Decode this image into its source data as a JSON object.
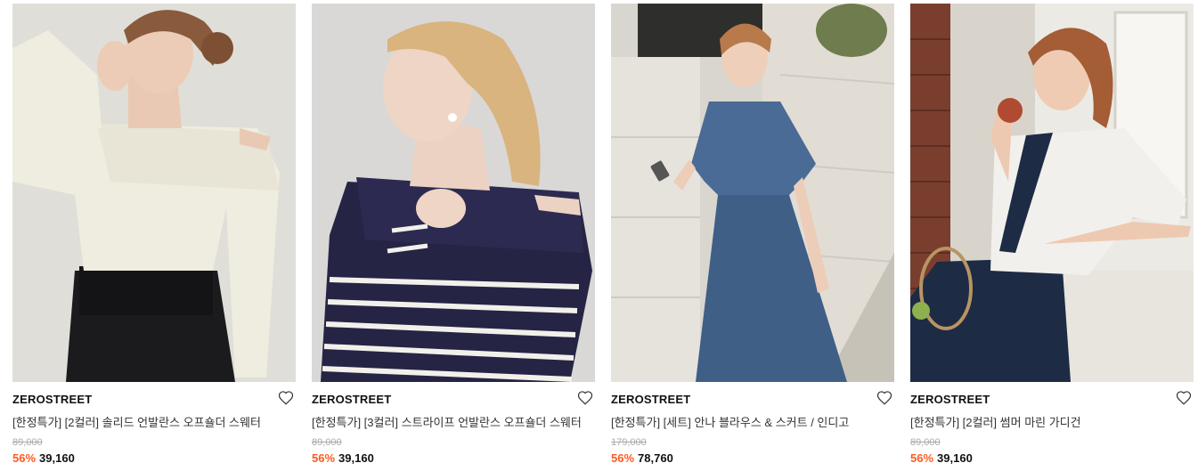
{
  "products": [
    {
      "brand": "ZEROSTREET",
      "title": "[한정특가] [2컬러] 솔리드 언발란스 오프숄더 스웨터",
      "original_price": "89,000",
      "discount": "56%",
      "price": "39,160",
      "image": "woman-in-cream-off-shoulder-sweater"
    },
    {
      "brand": "ZEROSTREET",
      "title": "[한정특가] [3컬러] 스트라이프 언발란스 오프숄더 스웨터",
      "original_price": "89,000",
      "discount": "56%",
      "price": "39,160",
      "image": "woman-in-navy-striped-off-shoulder-sweater"
    },
    {
      "brand": "ZEROSTREET",
      "title": "[한정특가] [세트] 안나 블라우스 & 스커트 / 인디고",
      "original_price": "179,000",
      "discount": "56%",
      "price": "78,760",
      "image": "woman-in-indigo-blouse-and-skirt-set"
    },
    {
      "brand": "ZEROSTREET",
      "title": "[한정특가] [2컬러] 썸머 마린 가디건",
      "original_price": "89,000",
      "discount": "56%",
      "price": "39,160",
      "image": "woman-in-white-marine-cardigan"
    }
  ],
  "colors": {
    "discount": "#ff5a1f",
    "brand": "#111111",
    "strike": "#aaaaaa"
  }
}
